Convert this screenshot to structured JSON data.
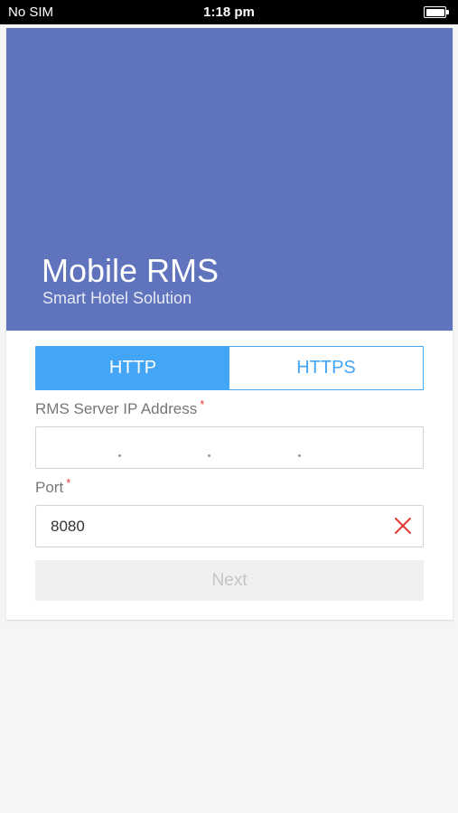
{
  "status_bar": {
    "carrier": "No SIM",
    "time": "1:18 pm",
    "battery_icon": "battery-full-icon"
  },
  "hero": {
    "title": "Mobile RMS",
    "subtitle": "Smart Hotel Solution",
    "background_color": "#5f74bc"
  },
  "protocol": {
    "options": [
      {
        "label": "HTTP",
        "selected": true
      },
      {
        "label": "HTTPS",
        "selected": false
      }
    ],
    "accent_color": "#42a5f5"
  },
  "ip_address": {
    "label": "RMS Server IP Address",
    "required_mark": "*",
    "value": ""
  },
  "port": {
    "label": "Port",
    "required_mark": "*",
    "value": "8080",
    "clear_icon": "close-icon"
  },
  "next_button": {
    "label": "Next",
    "enabled": false
  }
}
